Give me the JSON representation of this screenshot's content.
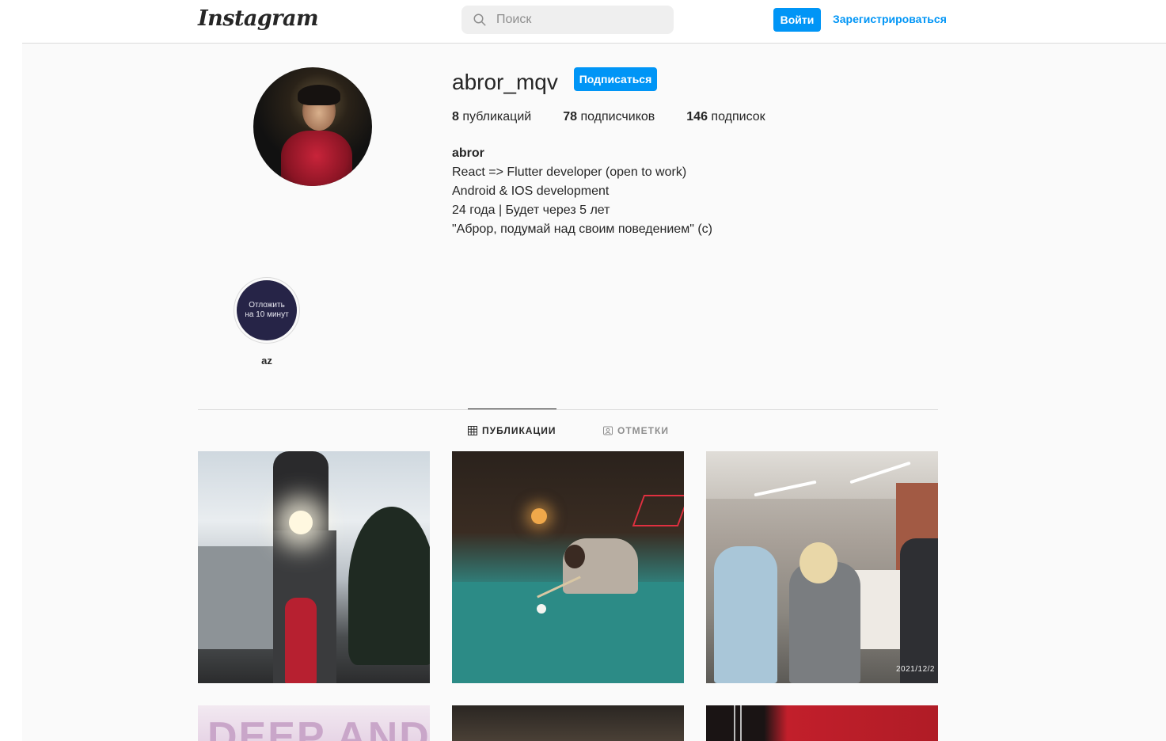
{
  "header": {
    "logo": "Instagram",
    "search_placeholder": "Поиск",
    "login_label": "Войти",
    "signup_label": "Зарегистрироваться"
  },
  "profile": {
    "username": "abror_mqv",
    "follow_label": "Подписаться",
    "stats": {
      "posts_count": "8",
      "posts_label": " публикаций",
      "followers_count": "78",
      "followers_label": " подписчиков",
      "following_count": "146",
      "following_label": " подписок"
    },
    "bio": {
      "name": "abror",
      "lines": [
        "React => Flutter developer (open to work)",
        "Android & IOS development",
        "24 года | Будет через 5 лет",
        "\"Аброр, подумай над своим поведением\" (c)"
      ]
    }
  },
  "highlights": [
    {
      "cover_text_1": "Отложить",
      "cover_text_2": "на 10 минут",
      "label": "az"
    }
  ],
  "tabs": {
    "posts": "ПУБЛИКАЦИИ",
    "tagged": "ОТМЕТКИ"
  },
  "posts": {
    "p3_date": "2021/12/2",
    "p4_text": "DEEP AND"
  },
  "colors": {
    "accent": "#0095f6",
    "text": "#262626",
    "muted": "#8e8e8e",
    "border": "#dbdbdb",
    "background": "#fafafa"
  }
}
